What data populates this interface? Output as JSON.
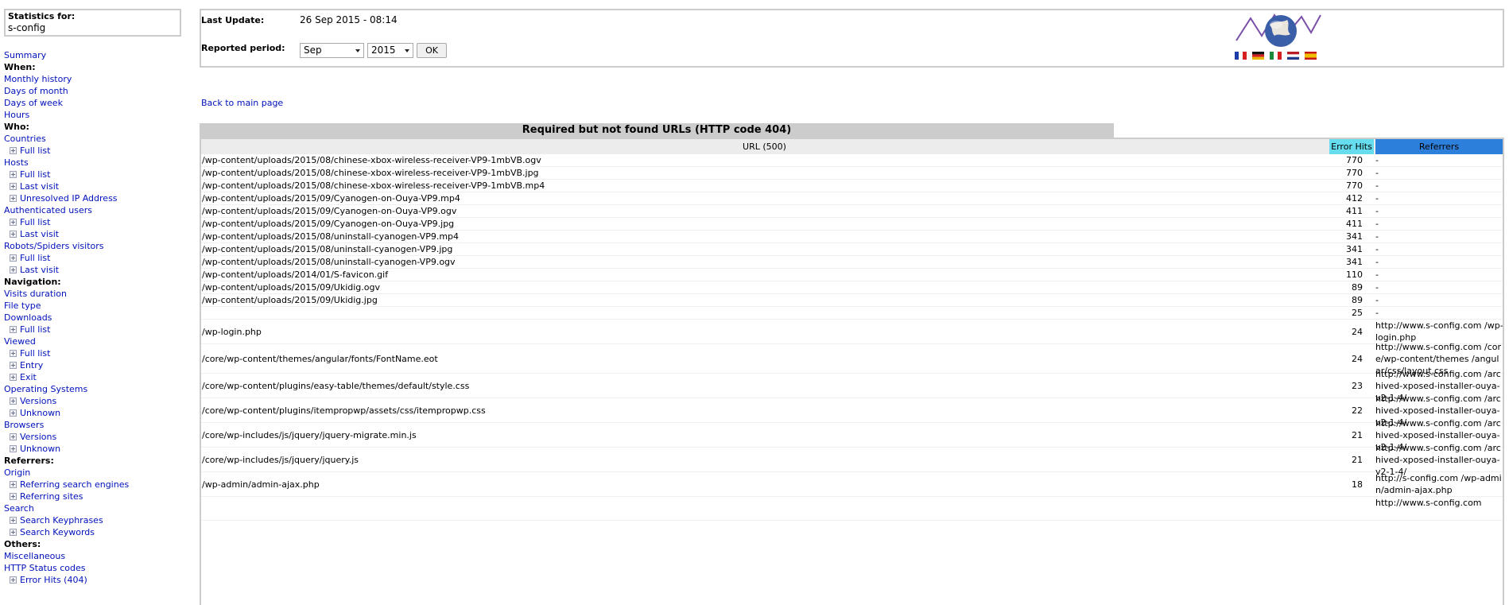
{
  "sidebar": {
    "stats_label": "Statistics for:",
    "site_name": "s-config",
    "items": [
      {
        "type": "link",
        "label": "Summary"
      },
      {
        "type": "head",
        "label": "When:"
      },
      {
        "type": "link",
        "label": "Monthly history"
      },
      {
        "type": "link",
        "label": "Days of month"
      },
      {
        "type": "link",
        "label": "Days of week"
      },
      {
        "type": "link",
        "label": "Hours"
      },
      {
        "type": "head",
        "label": "Who:"
      },
      {
        "type": "link",
        "label": "Countries"
      },
      {
        "type": "sub",
        "label": "Full list"
      },
      {
        "type": "link",
        "label": "Hosts"
      },
      {
        "type": "sub",
        "label": "Full list"
      },
      {
        "type": "sub",
        "label": "Last visit"
      },
      {
        "type": "sub",
        "label": "Unresolved IP Address"
      },
      {
        "type": "link",
        "label": "Authenticated users"
      },
      {
        "type": "sub",
        "label": "Full list"
      },
      {
        "type": "sub",
        "label": "Last visit"
      },
      {
        "type": "link",
        "label": "Robots/Spiders visitors"
      },
      {
        "type": "sub",
        "label": "Full list"
      },
      {
        "type": "sub",
        "label": "Last visit"
      },
      {
        "type": "head",
        "label": "Navigation:"
      },
      {
        "type": "link",
        "label": "Visits duration"
      },
      {
        "type": "link",
        "label": "File type"
      },
      {
        "type": "link",
        "label": "Downloads"
      },
      {
        "type": "sub",
        "label": "Full list"
      },
      {
        "type": "link",
        "label": "Viewed"
      },
      {
        "type": "sub",
        "label": "Full list"
      },
      {
        "type": "sub",
        "label": "Entry"
      },
      {
        "type": "sub",
        "label": "Exit"
      },
      {
        "type": "link",
        "label": "Operating Systems"
      },
      {
        "type": "sub",
        "label": "Versions"
      },
      {
        "type": "sub",
        "label": "Unknown"
      },
      {
        "type": "link",
        "label": "Browsers"
      },
      {
        "type": "sub",
        "label": "Versions"
      },
      {
        "type": "sub",
        "label": "Unknown"
      },
      {
        "type": "head",
        "label": "Referrers:"
      },
      {
        "type": "link",
        "label": "Origin"
      },
      {
        "type": "sub",
        "label": "Referring search engines"
      },
      {
        "type": "sub",
        "label": "Referring sites"
      },
      {
        "type": "link",
        "label": "Search"
      },
      {
        "type": "sub",
        "label": "Search Keyphrases"
      },
      {
        "type": "sub",
        "label": "Search Keywords"
      },
      {
        "type": "head",
        "label": "Others:"
      },
      {
        "type": "link",
        "label": "Miscellaneous"
      },
      {
        "type": "link",
        "label": "HTTP Status codes"
      },
      {
        "type": "sub",
        "label": "Error Hits (404)"
      }
    ]
  },
  "header": {
    "last_update_label": "Last Update:",
    "last_update_value": "26 Sep 2015 - 08:14",
    "period_label": "Reported period:",
    "month_value": "Sep",
    "year_value": "2015",
    "ok_label": "OK"
  },
  "back_link": "Back to main page",
  "table": {
    "title": "Required but not found URLs (HTTP code 404)",
    "col_url": "URL (500)",
    "col_hits": "Error Hits",
    "col_ref": "Referrers",
    "rows": [
      {
        "url": "/wp-content/uploads/2015/08/chinese-xbox-wireless-receiver-VP9-1mbVB.ogv",
        "hits": "770",
        "ref": "-"
      },
      {
        "url": "/wp-content/uploads/2015/08/chinese-xbox-wireless-receiver-VP9-1mbVB.jpg",
        "hits": "770",
        "ref": "-"
      },
      {
        "url": "/wp-content/uploads/2015/08/chinese-xbox-wireless-receiver-VP9-1mbVB.mp4",
        "hits": "770",
        "ref": "-"
      },
      {
        "url": "/wp-content/uploads/2015/09/Cyanogen-on-Ouya-VP9.mp4",
        "hits": "412",
        "ref": "-"
      },
      {
        "url": "/wp-content/uploads/2015/09/Cyanogen-on-Ouya-VP9.ogv",
        "hits": "411",
        "ref": "-"
      },
      {
        "url": "/wp-content/uploads/2015/09/Cyanogen-on-Ouya-VP9.jpg",
        "hits": "411",
        "ref": "-"
      },
      {
        "url": "/wp-content/uploads/2015/08/uninstall-cyanogen-VP9.mp4",
        "hits": "341",
        "ref": "-"
      },
      {
        "url": "/wp-content/uploads/2015/08/uninstall-cyanogen-VP9.jpg",
        "hits": "341",
        "ref": "-"
      },
      {
        "url": "/wp-content/uploads/2015/08/uninstall-cyanogen-VP9.ogv",
        "hits": "341",
        "ref": "-"
      },
      {
        "url": "/wp-content/uploads/2014/01/S-favicon.gif",
        "hits": "110",
        "ref": "-"
      },
      {
        "url": "/wp-content/uploads/2015/09/Ukidig.ogv",
        "hits": "89",
        "ref": "-"
      },
      {
        "url": "/wp-content/uploads/2015/09/Ukidig.jpg",
        "hits": "89",
        "ref": "-"
      },
      {
        "url": "",
        "hits": "25",
        "ref": "-"
      },
      {
        "url": "/wp-login.php",
        "hits": "24",
        "ref": "http://www.s-config.com /wp-login.php"
      },
      {
        "url": "/core/wp-content/themes/angular/fonts/FontName.eot",
        "hits": "24",
        "ref": "http://www.s-config.com /core/wp-content/themes /angular/css/layout.css"
      },
      {
        "url": "/core/wp-content/plugins/easy-table/themes/default/style.css",
        "hits": "23",
        "ref": "http://www.s-config.com /archived-xposed-installer-ouya-v2-1-4/"
      },
      {
        "url": "/core/wp-content/plugins/itempropwp/assets/css/itempropwp.css",
        "hits": "22",
        "ref": "http://www.s-config.com /archived-xposed-installer-ouya-v2-1-4/"
      },
      {
        "url": "/core/wp-includes/js/jquery/jquery-migrate.min.js",
        "hits": "21",
        "ref": "http://www.s-config.com /archived-xposed-installer-ouya-v2-1-4/"
      },
      {
        "url": "/core/wp-includes/js/jquery/jquery.js",
        "hits": "21",
        "ref": "http://www.s-config.com /archived-xposed-installer-ouya-v2-1-4/"
      },
      {
        "url": "/wp-admin/admin-ajax.php",
        "hits": "18",
        "ref": "http://s-config.com /wp-admin/admin-ajax.php"
      },
      {
        "url": "",
        "hits": "",
        "ref": "http://www.s-config.com"
      }
    ]
  },
  "colors": {
    "hits_header": "#66ddee",
    "ref_header": "#2c7fdb",
    "link": "#0011bb",
    "border": "#cccccd"
  }
}
